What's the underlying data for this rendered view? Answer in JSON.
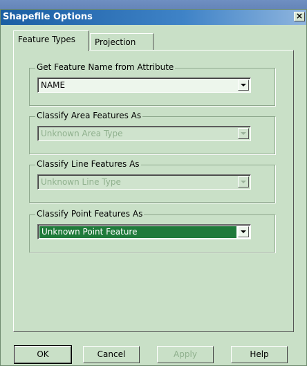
{
  "window": {
    "title": "Shapefile Options"
  },
  "tabs": [
    {
      "label": "Feature Types",
      "active": true
    },
    {
      "label": "Projection",
      "active": false
    }
  ],
  "groups": [
    {
      "label": "Get Feature Name from Attribute",
      "value": "NAME",
      "enabled": true,
      "selected": false
    },
    {
      "label": "Classify Area Features As",
      "value": "Unknown Area Type",
      "enabled": false,
      "selected": false
    },
    {
      "label": "Classify Line Features As",
      "value": "Unknown Line Type",
      "enabled": false,
      "selected": false
    },
    {
      "label": "Classify Point Features As",
      "value": "Unknown Point Feature",
      "enabled": true,
      "selected": true
    }
  ],
  "buttons": {
    "ok": "OK",
    "cancel": "Cancel",
    "apply": "Apply",
    "help": "Help"
  },
  "icons": {
    "close": "close-icon",
    "dropdown": "chevron-down-icon"
  },
  "colors": {
    "dialog_bg": "#c9e0c7",
    "titlebar": "#1b5ea3",
    "selection": "#1f7a3a"
  }
}
